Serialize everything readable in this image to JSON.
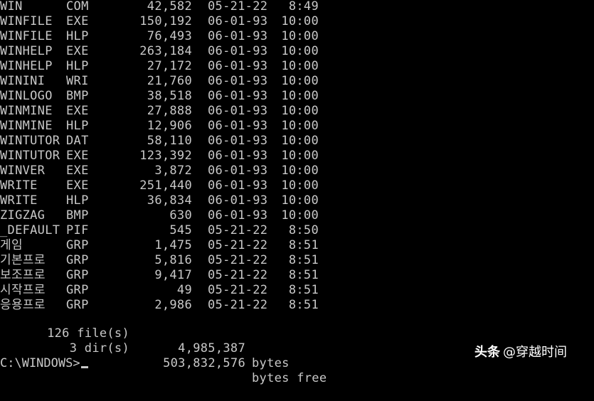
{
  "listing": [
    {
      "name": "WIN",
      "ext": "COM",
      "size": "42,582",
      "date": "05-21-22",
      "time": "8:49"
    },
    {
      "name": "WINFILE",
      "ext": "EXE",
      "size": "150,192",
      "date": "06-01-93",
      "time": "10:00"
    },
    {
      "name": "WINFILE",
      "ext": "HLP",
      "size": "76,493",
      "date": "06-01-93",
      "time": "10:00"
    },
    {
      "name": "WINHELP",
      "ext": "EXE",
      "size": "263,184",
      "date": "06-01-93",
      "time": "10:00"
    },
    {
      "name": "WINHELP",
      "ext": "HLP",
      "size": "27,172",
      "date": "06-01-93",
      "time": "10:00"
    },
    {
      "name": "WININI",
      "ext": "WRI",
      "size": "21,760",
      "date": "06-01-93",
      "time": "10:00"
    },
    {
      "name": "WINLOGO",
      "ext": "BMP",
      "size": "38,518",
      "date": "06-01-93",
      "time": "10:00"
    },
    {
      "name": "WINMINE",
      "ext": "EXE",
      "size": "27,888",
      "date": "06-01-93",
      "time": "10:00"
    },
    {
      "name": "WINMINE",
      "ext": "HLP",
      "size": "12,906",
      "date": "06-01-93",
      "time": "10:00"
    },
    {
      "name": "WINTUTOR",
      "ext": "DAT",
      "size": "58,110",
      "date": "06-01-93",
      "time": "10:00"
    },
    {
      "name": "WINTUTOR",
      "ext": "EXE",
      "size": "123,392",
      "date": "06-01-93",
      "time": "10:00"
    },
    {
      "name": "WINVER",
      "ext": "EXE",
      "size": "3,872",
      "date": "06-01-93",
      "time": "10:00"
    },
    {
      "name": "WRITE",
      "ext": "EXE",
      "size": "251,440",
      "date": "06-01-93",
      "time": "10:00"
    },
    {
      "name": "WRITE",
      "ext": "HLP",
      "size": "36,834",
      "date": "06-01-93",
      "time": "10:00"
    },
    {
      "name": "ZIGZAG",
      "ext": "BMP",
      "size": "630",
      "date": "06-01-93",
      "time": "10:00"
    },
    {
      "name": "_DEFAULT",
      "ext": "PIF",
      "size": "545",
      "date": "05-21-22",
      "time": "8:50"
    },
    {
      "name": "게임",
      "ext": "GRP",
      "size": "1,475",
      "date": "05-21-22",
      "time": "8:51"
    },
    {
      "name": "기본프로",
      "ext": "GRP",
      "size": "5,816",
      "date": "05-21-22",
      "time": "8:51"
    },
    {
      "name": "보조프로",
      "ext": "GRP",
      "size": "9,417",
      "date": "05-21-22",
      "time": "8:51"
    },
    {
      "name": "시작프로",
      "ext": "GRP",
      "size": "49",
      "date": "05-21-22",
      "time": "8:51"
    },
    {
      "name": "응용프로",
      "ext": "GRP",
      "size": "2,986",
      "date": "05-21-22",
      "time": "8:51"
    }
  ],
  "summary": {
    "files_count": "126 file(s)",
    "files_bytes": "4,985,387",
    "files_label": "bytes",
    "dirs_count": "3 dir(s)",
    "dirs_bytes": "503,832,576",
    "dirs_label": "bytes free"
  },
  "prompt": "C:\\WINDOWS>",
  "watermark": {
    "brand": "头条",
    "handle": "@穿越时间"
  },
  "colors": {
    "background": "#000000",
    "text": "#c8c8c8"
  }
}
